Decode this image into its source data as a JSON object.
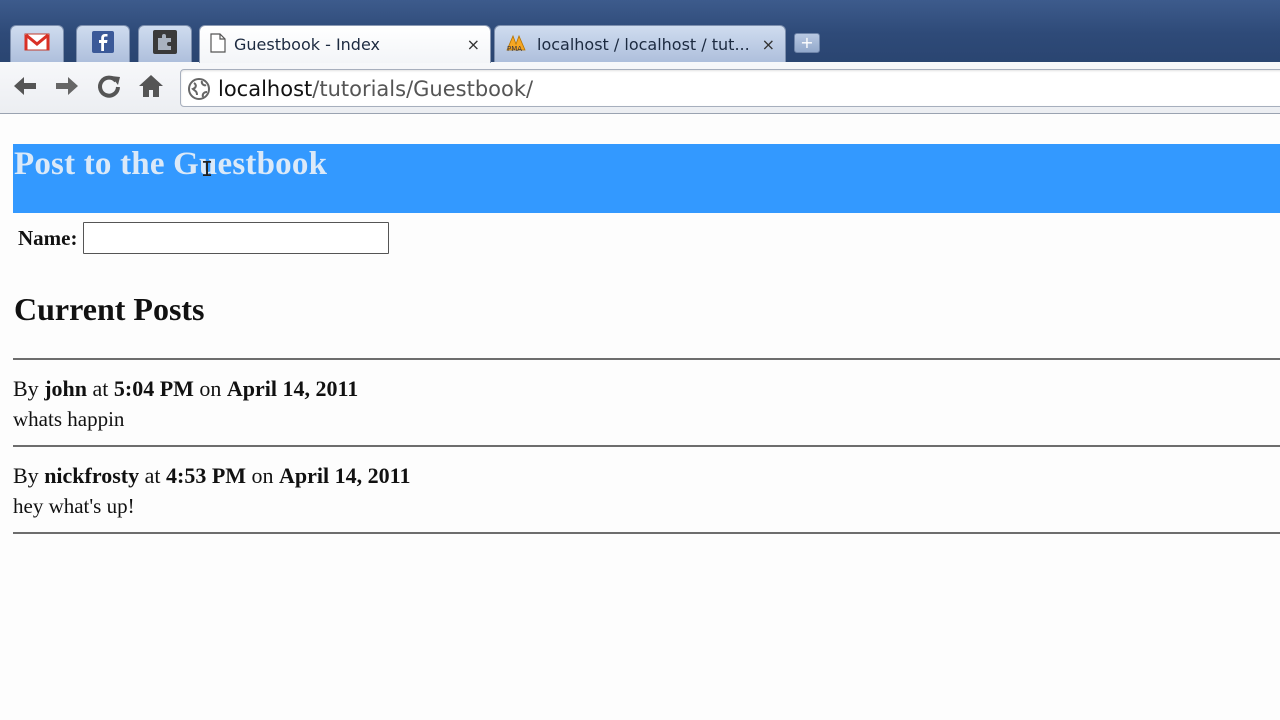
{
  "browser": {
    "tabs": [
      {
        "name": "gmail",
        "label": "",
        "icon": "gmail-icon"
      },
      {
        "name": "facebook",
        "label": "",
        "icon": "facebook-icon"
      },
      {
        "name": "extension",
        "label": "",
        "icon": "puzzle-icon"
      },
      {
        "name": "guestbook",
        "label": "Guestbook - Index",
        "icon": "page-icon",
        "active": true
      },
      {
        "name": "phpmyadmin",
        "label": "localhost / localhost / tut...",
        "icon": "phpmyadmin-icon"
      }
    ],
    "new_tab_label": "+",
    "close_label": "×",
    "url_host": "localhost",
    "url_path": "/tutorials/Guestbook/"
  },
  "page": {
    "banner_title": "Post to the Guestbook",
    "name_label": "Name:",
    "name_value": "",
    "current_posts_title": "Current Posts",
    "posts": [
      {
        "by": "By",
        "author": "john",
        "at": "at",
        "time": "5:04 PM",
        "on": "on",
        "date": "April 14, 2011",
        "body": "whats happin"
      },
      {
        "by": "By",
        "author": "nickfrosty",
        "at": "at",
        "time": "4:53 PM",
        "on": "on",
        "date": "April 14, 2011",
        "body": "hey what's up!"
      }
    ]
  },
  "colors": {
    "banner": "#3399ff",
    "banner_text": "#dbe9f8",
    "titlebar": "#2e4a78"
  }
}
